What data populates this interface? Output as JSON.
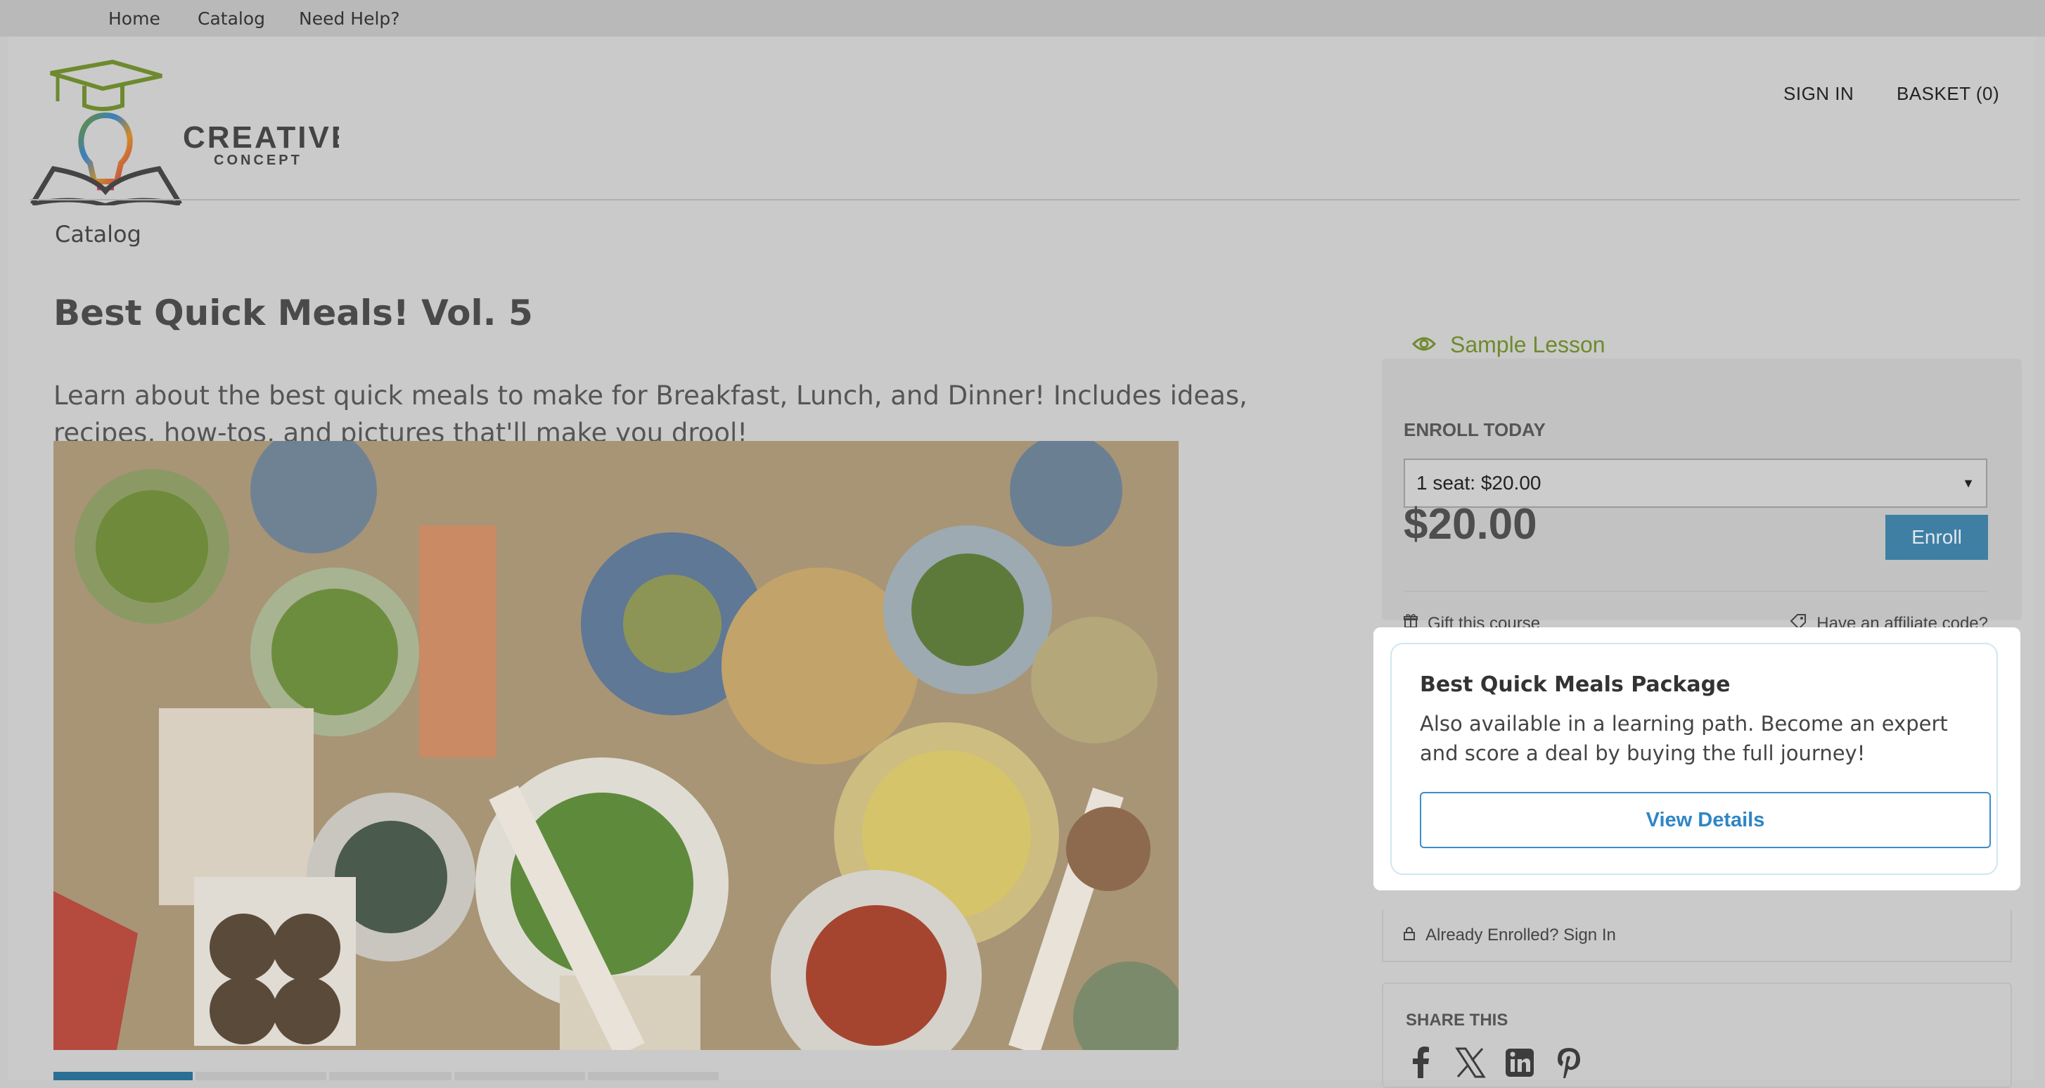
{
  "top_nav": {
    "home": "Home",
    "catalog": "Catalog",
    "help": "Need Help?"
  },
  "brand": {
    "name_line1": "CREATIVE",
    "name_line2": "CONCEPT"
  },
  "header": {
    "sign_in": "SIGN IN",
    "basket": "BASKET (0)"
  },
  "breadcrumb": "Catalog",
  "course": {
    "title": "Best Quick Meals! Vol. 5",
    "description": "Learn about the best quick meals to make for Breakfast, Lunch, and Dinner! Includes ideas, recipes, how-tos, and pictures that'll make you drool!"
  },
  "sidebar": {
    "sample_lesson": "Sample Lesson",
    "enroll_heading": "ENROLL TODAY",
    "seat_option": "1 seat: $20.00",
    "price": "$20.00",
    "enroll_button": "Enroll",
    "gift": "Gift this course",
    "affiliate": "Have an affiliate code?",
    "package": {
      "title": "Best Quick Meals Package",
      "text": "Also available in a learning path. Become an expert and score a deal by buying the full journey!",
      "button": "View Details"
    },
    "already_enrolled": "Already Enrolled? Sign In",
    "share_heading": "SHARE THIS"
  },
  "colors": {
    "accent_green": "#6f8a2c",
    "enroll_blue": "#3f7fa3",
    "link_blue": "#2f86c4",
    "active_tab": "#2a6f95"
  },
  "icons": [
    "eye-icon",
    "gift-icon",
    "tag-icon",
    "lock-icon",
    "facebook-icon",
    "x-icon",
    "linkedin-icon",
    "pinterest-icon",
    "chevron-down-icon"
  ]
}
